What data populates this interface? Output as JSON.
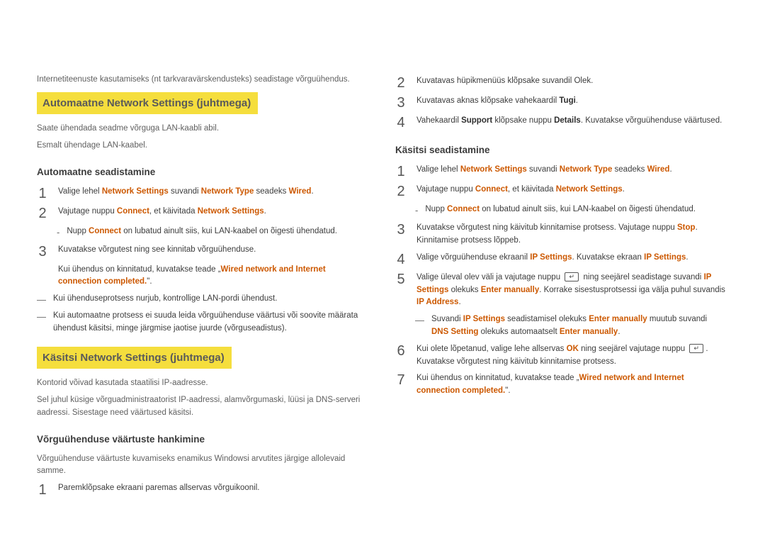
{
  "left": {
    "intro": "Internetiteenuste kasutamiseks (nt tarkvaravärskendusteks) seadistage võrguühendus.",
    "h1": "Automaatne Network Settings (juhtmega)",
    "p1": "Saate ühendada seadme võrguga LAN-kaabli abil.",
    "p2": "Esmalt ühendage LAN-kaabel.",
    "h2": "Automaatne seadistamine",
    "s1a": "Valige lehel ",
    "s1b": "Network Settings",
    "s1c": " suvandi ",
    "s1d": "Network Type",
    "s1e": " seadeks ",
    "s1f": "Wired",
    "s1g": ".",
    "s2a": "Vajutage nuppu ",
    "s2b": "Connect",
    "s2c": ", et käivitada ",
    "s2d": "Network Settings",
    "s2e": ".",
    "d1a": "Nupp ",
    "d1b": "Connect",
    "d1c": " on lubatud ainult siis, kui LAN-kaabel on õigesti ühendatud.",
    "s3": "Kuvatakse võrgutest ning see kinnitab võrguühenduse.",
    "s3sub_a": "Kui ühendus on kinnitatud, kuvatakse teade „",
    "s3sub_b": "Wired network and Internet connection completed.",
    "s3sub_c": "\".",
    "dash2": "Kui ühenduseprotsess nurjub, kontrollige LAN-pordi ühendust.",
    "dash3": "Kui automaatne protsess ei suuda leida võrguühenduse väärtusi või soovite määrata ühendust käsitsi, minge järgmise jaotise juurde (võrguseadistus).",
    "h3": "Käsitsi Network Settings (juhtmega)",
    "p3": "Kontorid võivad kasutada staatilisi IP-aadresse.",
    "p4": "Sel juhul küsige võrguadministraatorist IP-aadressi, alamvõrgumaski, lüüsi ja DNS-serveri aadressi. Sisestage need väärtused käsitsi.",
    "h4": "Võrguühenduse väärtuste hankimine",
    "p5": "Võrguühenduse väärtuste kuvamiseks enamikus Windowsi arvutites järgige allolevaid samme.",
    "s_b1": "Paremklõpsake ekraani paremas allservas võrguikoonil."
  },
  "right": {
    "s2": "Kuvatavas hüpikmenüüs klõpsake suvandil Olek.",
    "s3a": "Kuvatavas aknas klõpsake vahekaardil ",
    "s3b": "Tugi",
    "s3c": ".",
    "s4a": "Vahekaardil ",
    "s4b": "Support",
    "s4c": " klõpsake nuppu ",
    "s4d": "Details",
    "s4e": ". Kuvatakse võrguühenduse väärtused.",
    "h1": "Käsitsi seadistamine",
    "k1a": "Valige lehel ",
    "k1b": "Network Settings",
    "k1c": " suvandi ",
    "k1d": "Network Type",
    "k1e": " seadeks ",
    "k1f": "Wired",
    "k1g": ".",
    "k2a": "Vajutage nuppu ",
    "k2b": "Connect",
    "k2c": ", et käivitada ",
    "k2d": "Network Settings",
    "k2e": ".",
    "kd1a": "Nupp ",
    "kd1b": "Connect",
    "kd1c": " on lubatud ainult siis, kui LAN-kaabel on õigesti ühendatud.",
    "k3a": "Kuvatakse võrgutest ning käivitub kinnitamise protsess. Vajutage nuppu ",
    "k3b": "Stop",
    "k3c": ". Kinnitamise protsess lõppeb.",
    "k4a": "Valige võrguühenduse ekraanil ",
    "k4b": "IP Settings",
    "k4c": ". Kuvatakse ekraan ",
    "k4d": "IP Settings",
    "k4e": ".",
    "k5a": "Valige üleval olev väli ja vajutage nuppu ",
    "k5b": " ning seejärel seadistage suvandi ",
    "k5c": "IP Settings",
    "k5d": " olekuks ",
    "k5e": "Enter manually",
    "k5f": ". Korrake sisestusprotsessi iga välja puhul suvandis ",
    "k5g": "IP Address",
    "k5h": ".",
    "kd2a": "Suvandi ",
    "kd2b": "IP Settings",
    "kd2c": " seadistamisel olekuks ",
    "kd2d": "Enter manually",
    "kd2e": " muutub suvandi ",
    "kd2f": "DNS Setting",
    "kd2g": " olekuks automaatselt ",
    "kd2h": "Enter manually",
    "kd2i": ".",
    "k6a": "Kui olete lõpetanud, valige lehe allservas ",
    "k6b": "OK",
    "k6c": " ning seejärel vajutage nuppu ",
    "k6d": ". Kuvatakse võrgutest ning käivitub kinnitamise protsess.",
    "k7a": "Kui ühendus on kinnitatud, kuvatakse teade „",
    "k7b": "Wired network and Internet connection completed.",
    "k7c": "\"."
  }
}
